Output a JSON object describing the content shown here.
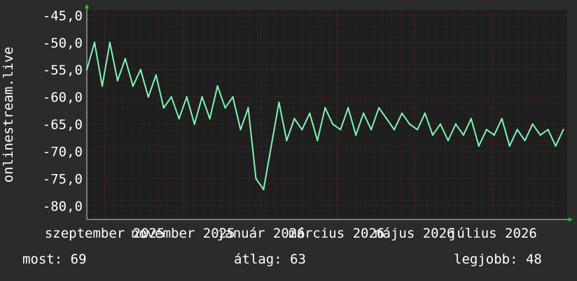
{
  "app": {
    "ylabel": "onlinestream.live"
  },
  "colors": {
    "background": "#2b2b2b",
    "plot_bg": "#1e1e1e",
    "grid": "#5a2d2d",
    "line": "#7ff5b5",
    "axis_arrow": "#00e000",
    "text": "#ffffff"
  },
  "stats": [
    {
      "label": "most:",
      "value": "69"
    },
    {
      "label": "átlag:",
      "value": "63"
    },
    {
      "label": "legjobb:",
      "value": "48"
    }
  ],
  "chart_data": {
    "type": "line",
    "title": "",
    "xlabel": "",
    "ylabel": "onlinestream.live",
    "ylim": [
      -82.5,
      -44.0
    ],
    "xlim": [
      "2025-08-18",
      "2026-08-28"
    ],
    "grid": true,
    "y_ticks": [
      {
        "value": -45,
        "label": "-45,0"
      },
      {
        "value": -50,
        "label": "-50,0"
      },
      {
        "value": -55,
        "label": "-55,0"
      },
      {
        "value": -60,
        "label": "-60,0"
      },
      {
        "value": -65,
        "label": "-65,0"
      },
      {
        "value": -70,
        "label": "-70,0"
      },
      {
        "value": -75,
        "label": "-75,0"
      },
      {
        "value": -80,
        "label": "-80,0"
      }
    ],
    "x_ticks": [
      {
        "date": "2025-09-01",
        "label": "szeptember 2025"
      },
      {
        "date": "2025-11-01",
        "label": "november 2025"
      },
      {
        "date": "2026-01-01",
        "label": "január 2026"
      },
      {
        "date": "2026-03-01",
        "label": "március 2026"
      },
      {
        "date": "2026-05-01",
        "label": "május 2026"
      },
      {
        "date": "2026-07-01",
        "label": "július 2026"
      }
    ],
    "series": [
      {
        "x": [
          "2025-08-18",
          "2025-08-24",
          "2025-08-30",
          "2025-09-05",
          "2025-09-11",
          "2025-09-17",
          "2025-09-23",
          "2025-09-29",
          "2025-10-05",
          "2025-10-11",
          "2025-10-17",
          "2025-10-23",
          "2025-10-29",
          "2025-11-04",
          "2025-11-10",
          "2025-11-16",
          "2025-11-22",
          "2025-11-28",
          "2025-12-04",
          "2025-12-10",
          "2025-12-16",
          "2025-12-22",
          "2025-12-28",
          "2026-01-03",
          "2026-01-09",
          "2026-01-15",
          "2026-01-21",
          "2026-01-27",
          "2026-02-02",
          "2026-02-08",
          "2026-02-14",
          "2026-02-20",
          "2026-02-26",
          "2026-03-04",
          "2026-03-10",
          "2026-03-16",
          "2026-03-22",
          "2026-03-28",
          "2026-04-03",
          "2026-04-09",
          "2026-04-15",
          "2026-04-21",
          "2026-04-27",
          "2026-05-03",
          "2026-05-09",
          "2026-05-15",
          "2026-05-21",
          "2026-05-27",
          "2026-06-02",
          "2026-06-08",
          "2026-06-14",
          "2026-06-20",
          "2026-06-26",
          "2026-07-02",
          "2026-07-08",
          "2026-07-14",
          "2026-07-20",
          "2026-07-26",
          "2026-08-01",
          "2026-08-07",
          "2026-08-13",
          "2026-08-19",
          "2026-08-25"
        ],
        "values": [
          -55,
          -50,
          -58,
          -50,
          -57,
          -53,
          -58,
          -55,
          -60,
          -56,
          -62,
          -60,
          -64,
          -60,
          -65,
          -60,
          -64,
          -58,
          -62,
          -60,
          -66,
          -62,
          -75,
          -77,
          -69,
          -61,
          -68,
          -64,
          -66,
          -63,
          -68,
          -62,
          -65,
          -66,
          -62,
          -67,
          -63,
          -66,
          -62,
          -64,
          -66,
          -63,
          -65,
          -66,
          -63,
          -67,
          -65,
          -68,
          -65,
          -67,
          -64,
          -69,
          -66,
          -67,
          -64,
          -69,
          -66,
          -68,
          -65,
          -67,
          -66,
          -69,
          -66
        ]
      }
    ]
  }
}
